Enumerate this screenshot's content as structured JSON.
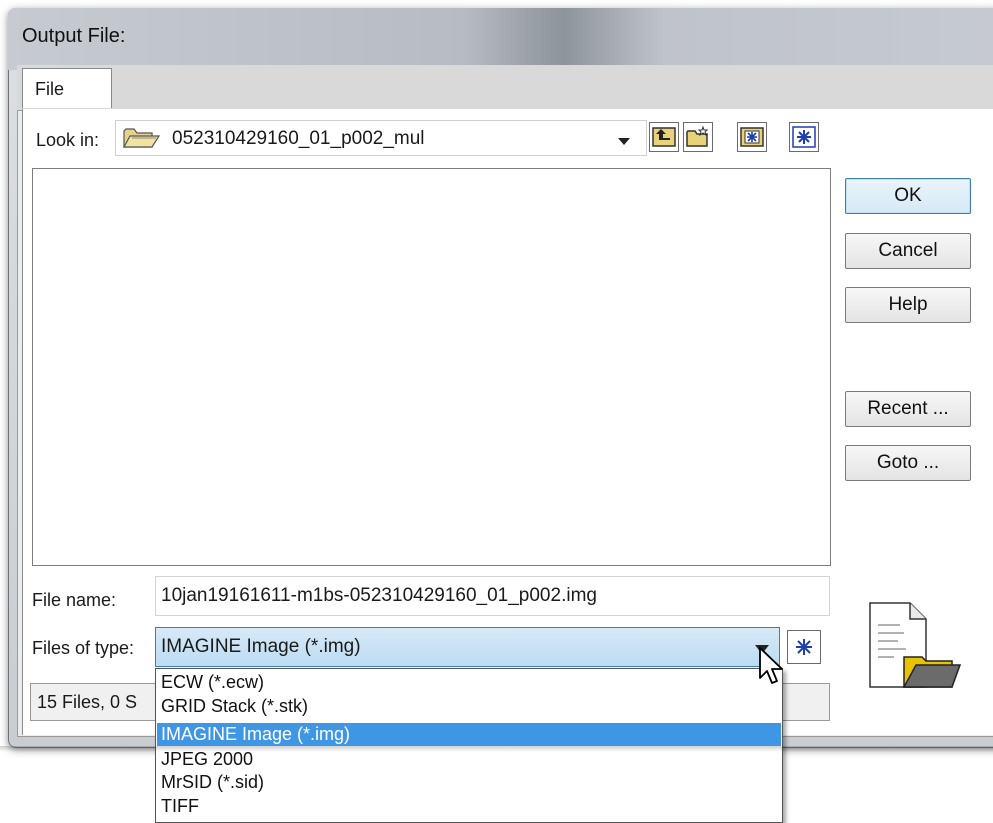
{
  "window": {
    "title": "Output File:"
  },
  "tabs": [
    {
      "label": "File"
    }
  ],
  "look_in": {
    "label": "Look in:",
    "value": "052310429160_01_p002_mul",
    "folder_icon": "open-folder-icon"
  },
  "toolbar": {
    "icons": [
      "up-folder-icon",
      "new-folder-icon",
      "view-icon",
      "sparkle-icon"
    ]
  },
  "buttons": {
    "ok": "OK",
    "cancel": "Cancel",
    "help": "Help",
    "recent": "Recent ...",
    "goto": "Goto ..."
  },
  "file_name": {
    "label": "File name:",
    "value": "10jan19161611-m1bs-052310429160_01_p002.img"
  },
  "files_of_type": {
    "label": "Files of type:",
    "value": "IMAGINE Image (*.img)",
    "options": [
      "ECW (*.ecw)",
      "GRID Stack (*.stk)",
      "IMAGINE Image (*.img)",
      "JPEG 2000",
      "MrSID (*.sid)",
      "TIFF"
    ],
    "selected_index": 2
  },
  "status": {
    "text": "15 Files, 0 S"
  },
  "decor": {
    "large_icon": "document-folder-icon"
  },
  "colors": {
    "selection": "#3f96e4",
    "focus_border": "#3c7fb1",
    "combo_bg": "#bcdcf2"
  }
}
